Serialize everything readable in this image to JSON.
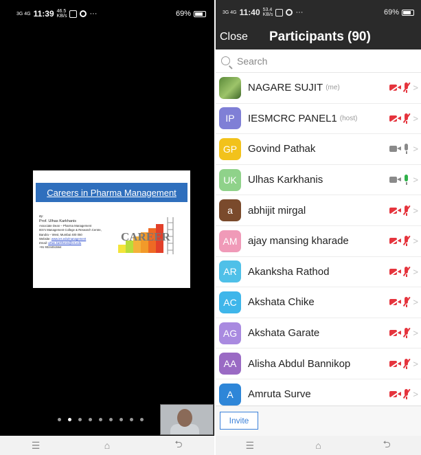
{
  "left_phone": {
    "status_bar": {
      "signal_text": "3G 4G",
      "time": "11:39",
      "speed": "46.5",
      "speed_unit": "KB/s",
      "battery": "69%"
    },
    "slide": {
      "title": "Careers in Pharma Management",
      "by_label": "By:",
      "presenter": "Prof. Ulhas Karkhanis",
      "line1": "Associate Dean – Pharma Management",
      "line2": "IES's Management College & Research Centre,",
      "line3": "Bandra – West, Mumbai 400 050",
      "website_label": "Website:",
      "website": "www.ies.edu/management",
      "email_label": "Email:",
      "email": "ulhas.karkhanis@ies.edu",
      "phone": "+91 9324451564",
      "graphic_text": "CAREER"
    },
    "page_dots": {
      "count": 9,
      "active_index": 1
    },
    "nav": {
      "menu": "☰",
      "home": "⌂",
      "back": "⮌"
    }
  },
  "right_phone": {
    "status_bar": {
      "signal_text": "3G 4G",
      "time": "11:40",
      "speed": "53.4",
      "speed_unit": "KB/s",
      "battery": "69%"
    },
    "header": {
      "close": "Close",
      "title": "Participants (90)"
    },
    "search": {
      "placeholder": "Search"
    },
    "participants": [
      {
        "initials": "",
        "photo": true,
        "name": "NAGARE SUJIT",
        "role": "(me)",
        "color": "#6a9a48",
        "cam": "off",
        "mic": "off"
      },
      {
        "initials": "IP",
        "name": "IESMCRC PANEL1",
        "role": "(host)",
        "color": "#7f7fd6",
        "cam": "off",
        "mic": "off"
      },
      {
        "initials": "GP",
        "name": "Govind Pathak",
        "role": "",
        "color": "#f2c21b",
        "cam": "on",
        "mic": "gray"
      },
      {
        "initials": "UK",
        "name": "Ulhas Karkhanis",
        "role": "",
        "color": "#8fd28a",
        "cam": "on",
        "mic": "green"
      },
      {
        "initials": "a",
        "name": "abhijit mirgal",
        "role": "",
        "color": "#7a4a2c",
        "cam": "off",
        "mic": "off"
      },
      {
        "initials": "AM",
        "name": "ajay mansing kharade",
        "role": "",
        "color": "#f09ab8",
        "cam": "off",
        "mic": "off"
      },
      {
        "initials": "AR",
        "name": "Akanksha Rathod",
        "role": "",
        "color": "#4fc0e8",
        "cam": "off",
        "mic": "off"
      },
      {
        "initials": "AC",
        "name": "Akshata Chike",
        "role": "",
        "color": "#3fb6ea",
        "cam": "off",
        "mic": "off"
      },
      {
        "initials": "AG",
        "name": "Akshata Garate",
        "role": "",
        "color": "#a98ae0",
        "cam": "off",
        "mic": "off"
      },
      {
        "initials": "AA",
        "name": "Alisha Abdul Bannikop",
        "role": "",
        "color": "#9a6ac4",
        "cam": "off",
        "mic": "off"
      },
      {
        "initials": "A",
        "name": "Amruta Surve",
        "role": "",
        "color": "#2e86d8",
        "cam": "off",
        "mic": "off"
      }
    ],
    "invite": "Invite",
    "nav": {
      "menu": "☰",
      "home": "⌂",
      "back": "⮌"
    }
  }
}
